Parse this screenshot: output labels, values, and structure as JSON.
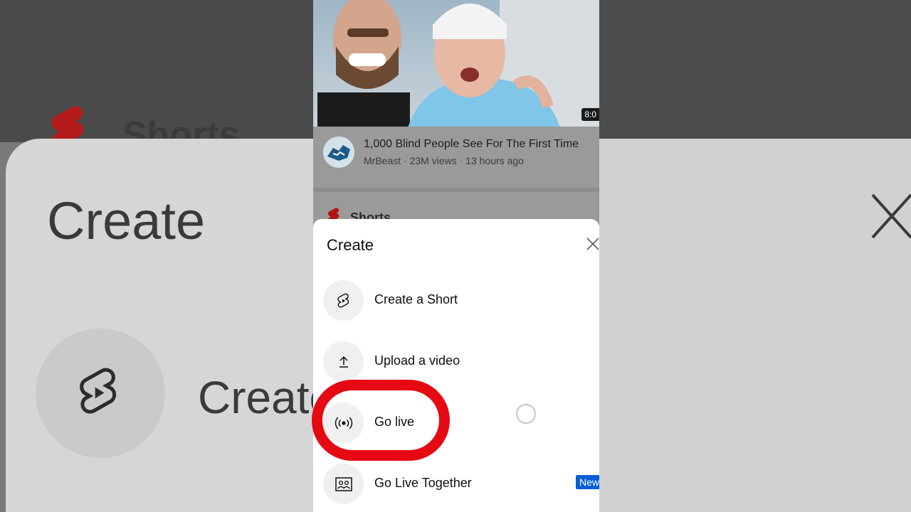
{
  "background": {
    "left_title": "Create",
    "left_row_label": "Create",
    "left_section_label": "Shorts"
  },
  "video": {
    "title": "1,000 Blind People See For The First Time",
    "channel": "MrBeast",
    "views": "23M views",
    "age": "13 hours ago",
    "separator": " · ",
    "duration": "8:0"
  },
  "shorts_section": {
    "label": "Shorts"
  },
  "create_sheet": {
    "title": "Create",
    "items": [
      {
        "label": "Create a Short",
        "icon": "shorts-icon"
      },
      {
        "label": "Upload a video",
        "icon": "upload-icon"
      },
      {
        "label": "Go live",
        "icon": "broadcast-icon"
      },
      {
        "label": "Go Live Together",
        "icon": "group-icon",
        "badge": "New"
      }
    ]
  },
  "colors": {
    "accent_red": "#e50914",
    "youtube_red": "#ff0000",
    "badge_blue": "#065fd4"
  }
}
